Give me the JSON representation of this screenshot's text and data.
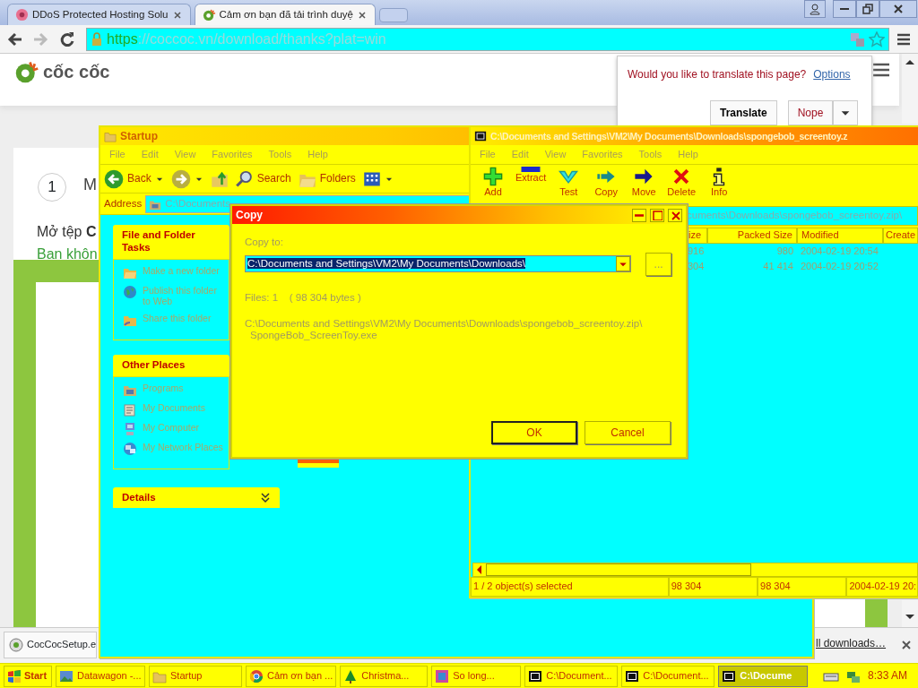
{
  "browser": {
    "tabs": [
      {
        "label": "DDoS Protected Hosting Solu",
        "kind": "flower",
        "selected": false
      },
      {
        "label": "Cảm ơn bạn đã tải trình duyệ",
        "kind": "coccoc",
        "selected": true
      }
    ],
    "url": {
      "scheme": "https",
      "rest": "://coccoc.vn/download/thanks?plat=win"
    }
  },
  "page": {
    "logo": "cốc cốc",
    "step_number": "1",
    "step_title": "M",
    "line_1": "Mở tệp **C**",
    "line_2": "Bạn khôn"
  },
  "translate_bar": {
    "question": "Would you like to translate this page?",
    "options_link": "Options",
    "translate_button": "Translate",
    "nope_button": "Nope"
  },
  "explorer": {
    "title": "Startup",
    "menu": [
      "File",
      "Edit",
      "View",
      "Favorites",
      "Tools",
      "Help"
    ],
    "toolbar": [
      {
        "kind": "back",
        "label": "Back"
      },
      {
        "kind": "forward"
      },
      {
        "kind": "up"
      },
      {
        "kind": "search",
        "label": "Search"
      },
      {
        "kind": "folders",
        "label": "Folders"
      },
      {
        "kind": "views"
      }
    ],
    "address_label": "Address",
    "address": "C:\\Documents",
    "panels": [
      {
        "title": "File and Folder Tasks",
        "items": [
          {
            "kind": "new-folder",
            "label": "Make a new folder"
          },
          {
            "kind": "globe",
            "label": "Publish this folder to Web"
          },
          {
            "kind": "share",
            "label": "Share this folder"
          }
        ]
      },
      {
        "title": "Other Places",
        "items": [
          {
            "kind": "programs",
            "label": "Programs"
          },
          {
            "kind": "documents",
            "label": "My Documents"
          },
          {
            "kind": "computer",
            "label": "My Computer"
          },
          {
            "kind": "network",
            "label": "My Network Places"
          }
        ]
      }
    ],
    "details": "Details"
  },
  "seven_zip": {
    "title": "C:\\Documents and Settings\\VM2\\My Documents\\Downloads\\spongebob_screentoy.z",
    "menu": [
      "File",
      "Edit",
      "View",
      "Favorites",
      "Tools",
      "Help"
    ],
    "toolbar": [
      {
        "kind": "add",
        "label": "Add"
      },
      {
        "kind": "extract",
        "label": "Extract"
      },
      {
        "kind": "test",
        "label": "Test"
      },
      {
        "kind": "copy",
        "label": "Copy"
      },
      {
        "kind": "move",
        "label": "Move"
      },
      {
        "kind": "delete",
        "label": "Delete"
      },
      {
        "kind": "info",
        "label": "Info"
      }
    ],
    "path": "cuments\\Downloads\\spongebob_screentoy.zip\\",
    "columns": [
      "ize",
      "Packed Size",
      "Modified",
      "Create"
    ],
    "rows": [
      [
        "916",
        "980",
        "2004-02-19 20:54"
      ],
      [
        "304",
        "41 414",
        "2004-02-19 20:52"
      ]
    ],
    "status": [
      "1 / 2 object(s) selected",
      "98 304",
      "98 304",
      "2004-02-19 20:"
    ]
  },
  "copy_dialog": {
    "title": "Copy",
    "copy_to_label": "Copy to:",
    "destination": "C:\\Documents and Settings\\VM2\\My Documents\\Downloads\\",
    "destination_selected": true,
    "browse_button": "...",
    "files_info": "Files: 1    ( 98 304 bytes )",
    "source_lines": [
      "C:\\Documents and Settings\\VM2\\My Documents\\Downloads\\spongebob_screentoy.zip\\",
      "SpongeBob_ScreenToy.exe"
    ],
    "ok_button": "OK",
    "cancel_button": "Cancel"
  },
  "download_bar": {
    "file": "CocCocSetup.e",
    "show_all": "ll downloads…"
  },
  "taskbar": {
    "start": "Start",
    "items": [
      {
        "kind": "picture",
        "label": "Datawagon -...",
        "selected": false
      },
      {
        "kind": "folder",
        "label": "Startup",
        "selected": false
      },
      {
        "kind": "browser",
        "label": "Cảm ơn bạn ...",
        "selected": false
      },
      {
        "kind": "tree",
        "label": "Christma...",
        "selected": false
      },
      {
        "kind": "game",
        "label": "So long...",
        "selected": false
      },
      {
        "kind": "archive",
        "label": "C:\\Document...",
        "selected": false
      },
      {
        "kind": "archive",
        "label": "C:\\Document...",
        "selected": false
      },
      {
        "kind": "archive",
        "label": "C:\\Docume",
        "selected": true
      }
    ],
    "clock": "8:33 AM"
  }
}
